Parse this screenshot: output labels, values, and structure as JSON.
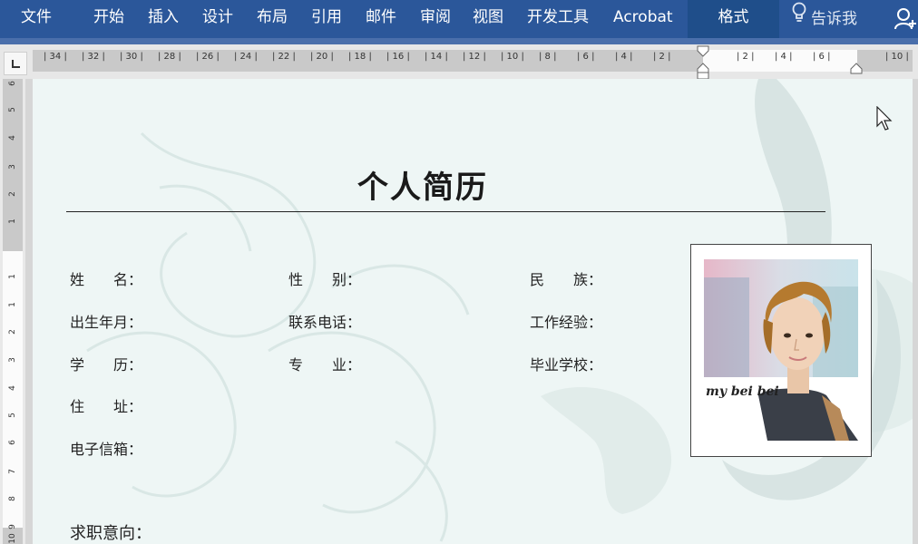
{
  "ribbon": {
    "tabs": [
      {
        "label": "文件",
        "name": "tab-file"
      },
      {
        "label": "开始",
        "name": "tab-home"
      },
      {
        "label": "插入",
        "name": "tab-insert"
      },
      {
        "label": "设计",
        "name": "tab-design"
      },
      {
        "label": "布局",
        "name": "tab-layout"
      },
      {
        "label": "引用",
        "name": "tab-references"
      },
      {
        "label": "邮件",
        "name": "tab-mailings"
      },
      {
        "label": "审阅",
        "name": "tab-review"
      },
      {
        "label": "视图",
        "name": "tab-view"
      },
      {
        "label": "开发工具",
        "name": "tab-developer"
      },
      {
        "label": "Acrobat",
        "name": "tab-acrobat"
      },
      {
        "label": "格式",
        "name": "tab-format"
      }
    ],
    "tell_me_label": "告诉我",
    "colors": {
      "ribbon_bg": "#2b579a",
      "active_tab": "#1f4e8a"
    }
  },
  "ruler": {
    "horizontal_ticks": [
      "34",
      "32",
      "30",
      "28",
      "26",
      "24",
      "22",
      "20",
      "18",
      "16",
      "14",
      "12",
      "10",
      "8",
      "6",
      "4",
      "2",
      "2",
      "4",
      "6",
      "10"
    ],
    "vertical_ticks": [
      "6",
      "5",
      "4",
      "3",
      "2",
      "1",
      "1",
      "1",
      "2",
      "3",
      "4",
      "5",
      "6",
      "7",
      "8",
      "9",
      "10"
    ]
  },
  "document": {
    "title": "个人简历",
    "fields": {
      "name": "姓　　名：",
      "gender": "性　　别：",
      "ethnicity": "民　　族：",
      "birth": "出生年月：",
      "phone": "联系电话：",
      "experience": "工作经验：",
      "education": "学　　历：",
      "major": "专　　业：",
      "school": "毕业学校：",
      "address": "住　　址：",
      "email": "电子信箱：",
      "objective": "求职意向："
    },
    "photo_caption": "my bei bei",
    "background_color": "#eef6f5"
  }
}
